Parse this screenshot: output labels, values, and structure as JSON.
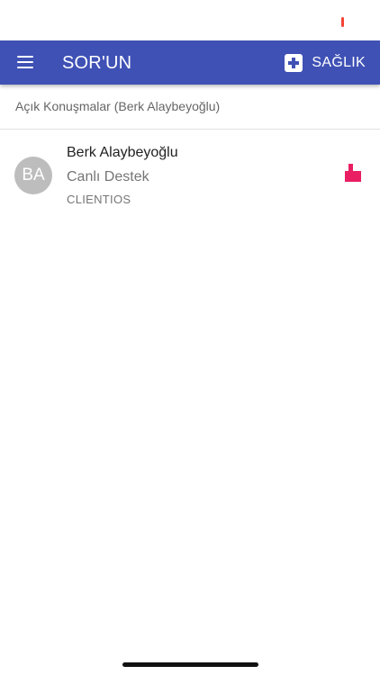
{
  "colors": {
    "primary": "#3F51B5",
    "accent": "#E91E63",
    "status_indicator": "#F44336"
  },
  "app_bar": {
    "title": "SOR'UN",
    "menu_icon": "hamburger-menu-icon",
    "action_icon": "medical-plus-icon",
    "action_label": "SAĞLIK"
  },
  "subheader": {
    "text": "Açık Konuşmalar (Berk Alaybeyoğlu)"
  },
  "conversations": [
    {
      "avatar_initials": "BA",
      "name": "Berk Alaybeyoğlu",
      "subtitle": "Canlı Destek",
      "tag": "CLIENTIOS",
      "status_icon": "mailbox-flag-icon"
    }
  ]
}
